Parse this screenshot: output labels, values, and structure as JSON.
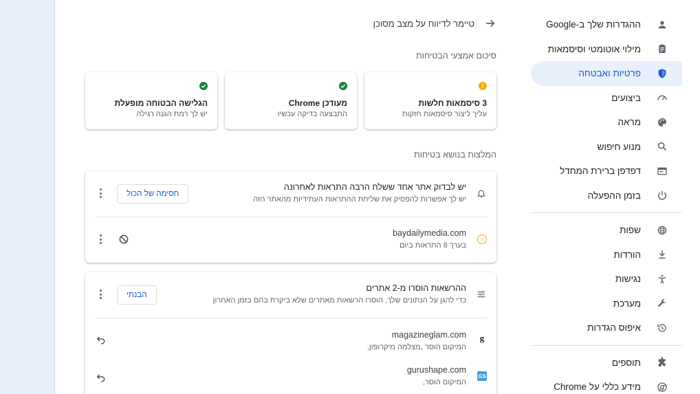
{
  "sidebar": {
    "items": [
      {
        "label": "ההגדרות שלך ב-Google",
        "icon": "person-icon"
      },
      {
        "label": "מילוי אוטומטי וסיסמאות",
        "icon": "clipboard-icon"
      },
      {
        "label": "פרטיות ואבטחה",
        "icon": "shield-icon",
        "active": true
      },
      {
        "label": "ביצועים",
        "icon": "speedometer-icon"
      },
      {
        "label": "מראה",
        "icon": "palette-icon"
      },
      {
        "label": "מנוע חיפוש",
        "icon": "search-icon"
      },
      {
        "label": "דפדפן ברירת המחדל",
        "icon": "browser-icon"
      },
      {
        "label": "בזמן ההפעלה",
        "icon": "power-icon"
      }
    ],
    "items2": [
      {
        "label": "שפות",
        "icon": "globe-icon"
      },
      {
        "label": "הורדות",
        "icon": "download-icon"
      },
      {
        "label": "נגישות",
        "icon": "accessibility-icon"
      },
      {
        "label": "מערכת",
        "icon": "wrench-icon"
      },
      {
        "label": "איפוס הגדרות",
        "icon": "history-icon"
      }
    ],
    "items3": [
      {
        "label": "תוספים",
        "icon": "puzzle-icon"
      },
      {
        "label": "מידע כללי על Chrome",
        "icon": "chrome-icon"
      }
    ]
  },
  "main": {
    "timer_label": "טיימר לדיווח על מצב מסוכן",
    "summary_title": "סיכום אמצעי הבטיחות",
    "cards": [
      {
        "title": "3 סיסמאות חלשות",
        "sub": "עליך ליצור סיסמאות חזקות",
        "status": "warning"
      },
      {
        "title": "מעודכן Chrome",
        "sub": "התבצעה בדיקה עכשיו",
        "status": "ok"
      },
      {
        "title": "הגלישה הבטוחה מופעלת",
        "sub": "יש לך רמת הגנה רגילה",
        "status": "ok"
      }
    ],
    "recommendations_title": "המלצות בנושא בטיחות",
    "notifications_panel": {
      "title": "יש לבדוק אתר אחד ששלח הרבה התראות לאחרונה",
      "sub": "יש לך אפשרות להפסיק את שליחת ההתראות העתידיות מהאתר הזה",
      "button": "חסימה של הכול",
      "site": {
        "domain": "baydailymedia.com",
        "sub": "בערך 8 התראות ביום"
      }
    },
    "permissions_panel": {
      "title": "ההרשאות הוסרו מ-2 אתרים",
      "sub": "כדי להגן על הנתונים שלך, הוסרו הרשאות מאתרים שלא ביקרת בהם בזמן האחרון",
      "button": "הבנתי",
      "sites": [
        {
          "domain": "magazineglam.com",
          "sub": "המיקום הוסר ,מצלמה מיקרופון,",
          "favicon": "g"
        },
        {
          "domain": "gurushape.com",
          "sub": "המיקום הוסר,",
          "favicon": "GS"
        }
      ]
    }
  },
  "colors": {
    "accent": "#1a57d6",
    "ok": "#188038",
    "warning": "#f9ab00"
  }
}
